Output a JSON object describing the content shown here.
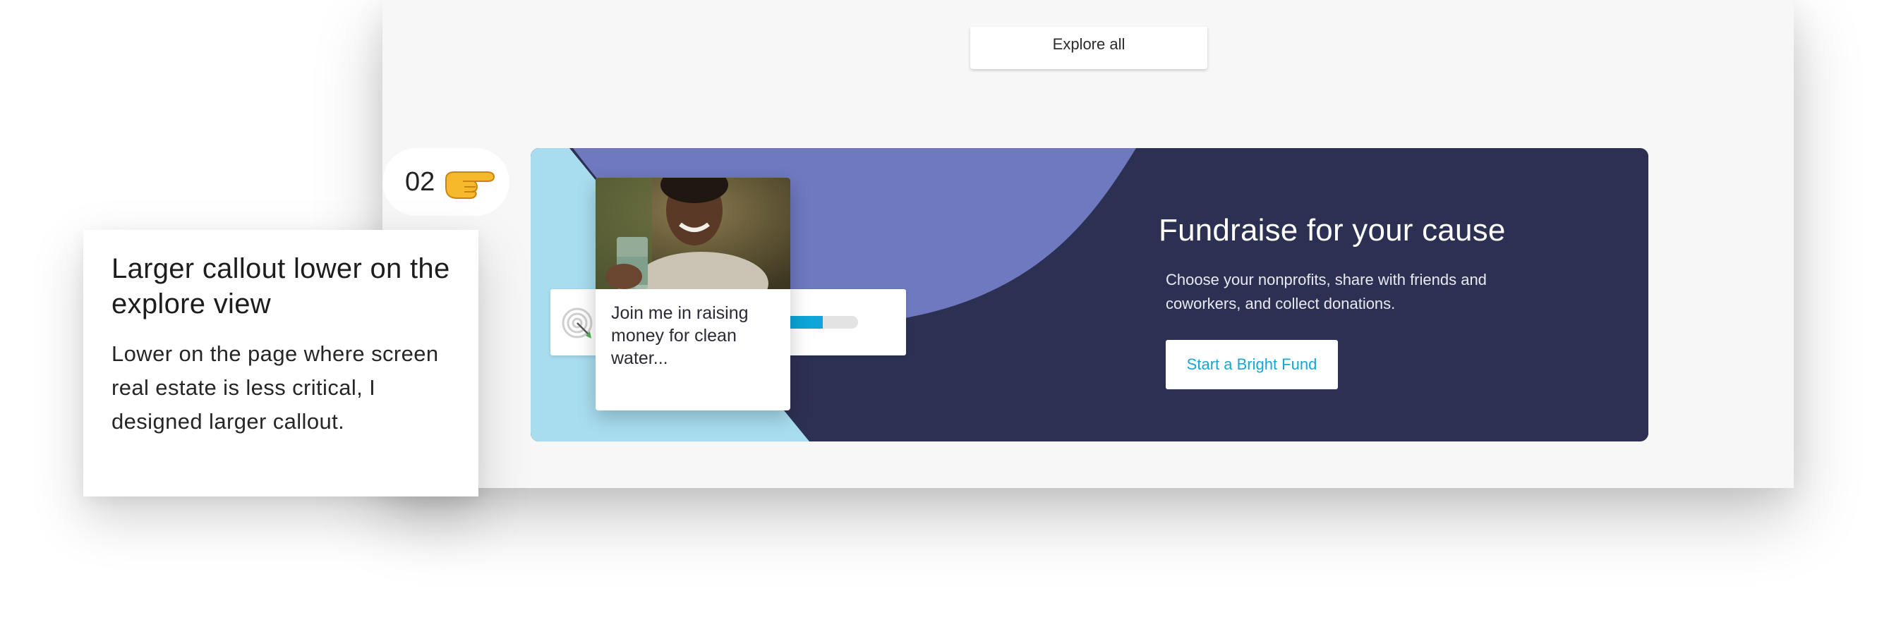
{
  "explore": {
    "label": "Explore all"
  },
  "banner": {
    "title": "Fundraise for your cause",
    "description": "Choose your nonprofits, share with friends and coworkers, and collect donations.",
    "cta_label": "Start a Bright Fund",
    "colors": {
      "background": "#2c3154",
      "accent_shape": "#6e79c0",
      "light_shape": "#a8ddf0",
      "cta_text": "#13a8d6"
    }
  },
  "card": {
    "caption": "Join me in raising money for clean water...",
    "progress_fraction": 0.6,
    "progress_color": "#0ea5d8",
    "icon": "target-icon"
  },
  "badge": {
    "number": "02",
    "icon": "pointing-hand-icon"
  },
  "callout": {
    "title": "Larger callout lower on the explore view",
    "body": "Lower on the page where screen real estate is less critical, I designed larger callout."
  }
}
